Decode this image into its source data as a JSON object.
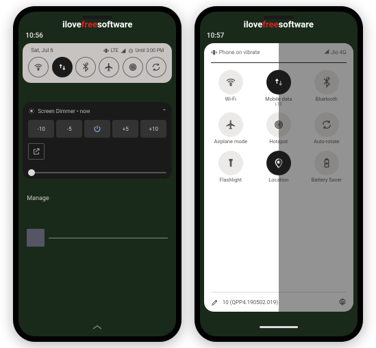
{
  "watermark": {
    "p1": "ilove",
    "p2": "free",
    "p3": "software"
  },
  "phone1": {
    "time": "10:56",
    "date": "Sat, Jul 6",
    "status": {
      "lte": "LTE",
      "alarm": "Until 3:00 PM"
    },
    "notif": {
      "title": "Screen Dimmer",
      "when": "now",
      "b1": "-10",
      "b2": "-5",
      "b3": "+5",
      "b4": "+10"
    },
    "manage": "Manage"
  },
  "phone2": {
    "time": "10:57",
    "vibrate": "Phone on vibrate",
    "carrier": "Jio 4G",
    "tiles": {
      "wifi": "Wi-Fi",
      "mobile": "Mobile data",
      "mobileSub": "LTE",
      "bt": "Bluetooth",
      "airplane": "Airplane mode",
      "hotspot": "Hotspot",
      "autorotate": "Auto-rotate",
      "flashlight": "Flashlight",
      "location": "Location",
      "battery": "Battery Saver"
    },
    "build": "10 (QPP4.190502.019)"
  }
}
